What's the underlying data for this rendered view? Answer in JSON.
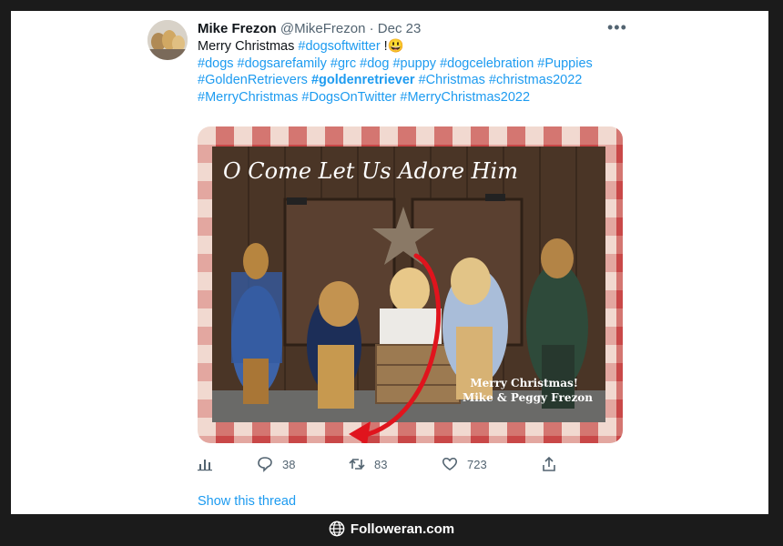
{
  "tweet": {
    "display_name": "Mike Frezon",
    "handle": "@MikeFrezon",
    "separator": "·",
    "date": "Dec 23",
    "more_label": "•••",
    "text_lead": "Merry Christmas ",
    "tag_dogsoftwitter": "#dogsoftwitter",
    "text_after": " !",
    "emoji": "😃",
    "hashtags_line1": [
      "#dogs",
      "#dogsarefamily",
      "#grc",
      "#dog",
      "#puppy",
      "#dogcelebration",
      "#Puppies"
    ],
    "hashtags_line2": [
      "#GoldenRetrievers",
      "#goldenretriever",
      "#Christmas",
      "#christmas2022"
    ],
    "hashtags_line3": [
      "#MerryChristmas",
      "#DogsOnTwitter",
      "#MerryChristmas2022"
    ]
  },
  "image": {
    "title": "O Come Let Us Adore Him",
    "caption_line1": "Merry Christmas!",
    "caption_line2": "Mike & Peggy Frezon"
  },
  "actions": {
    "replies": "38",
    "retweets": "83",
    "likes": "723"
  },
  "show_thread": "Show this thread",
  "watermark": "Followeran.com",
  "colors": {
    "link": "#1d9bf0",
    "text": "#0f1419",
    "muted": "#536471",
    "arrow": "#e0141d",
    "frame": "#1b1b1b"
  },
  "icons": [
    "more-icon",
    "analytics-icon",
    "reply-icon",
    "retweet-icon",
    "like-icon",
    "share-icon",
    "globe-icon"
  ]
}
